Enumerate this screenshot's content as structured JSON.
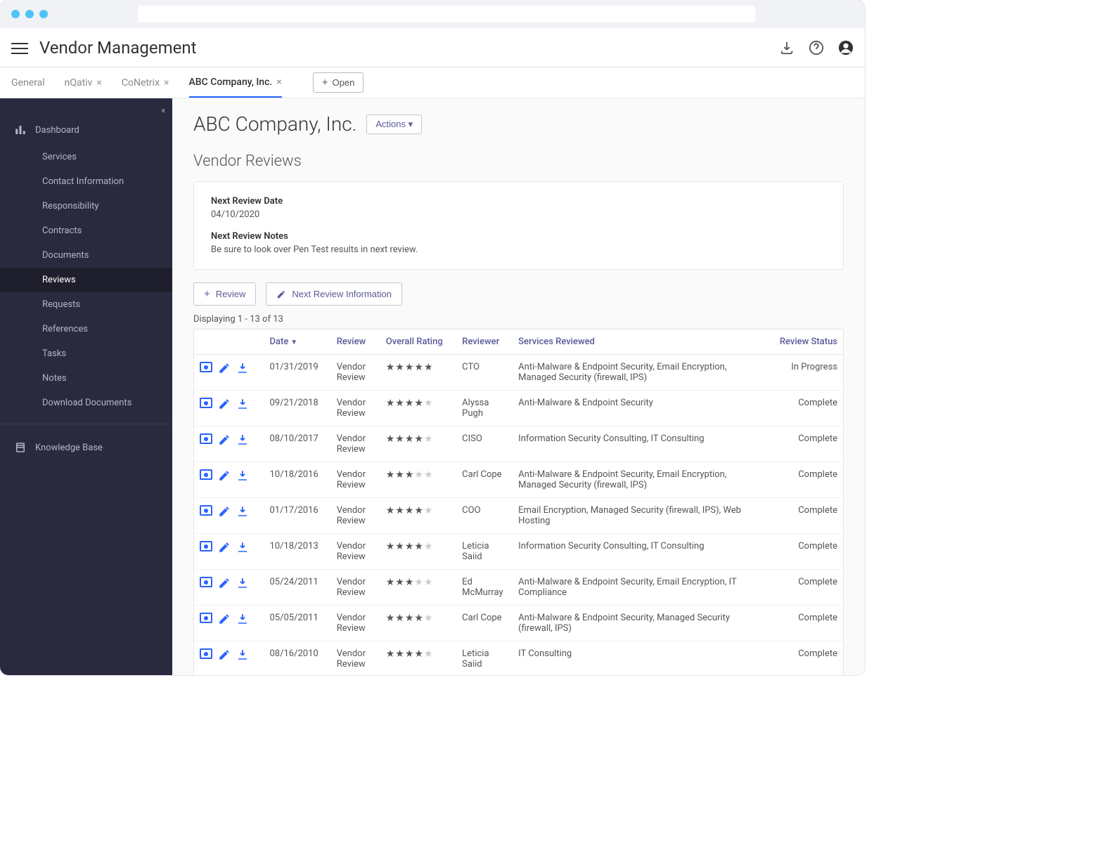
{
  "app_title": "Vendor Management",
  "tabs": [
    {
      "label": "General",
      "closable": false,
      "active": false
    },
    {
      "label": "nQativ",
      "closable": true,
      "active": false
    },
    {
      "label": "CoNetrix",
      "closable": true,
      "active": false
    },
    {
      "label": "ABC Company, Inc.",
      "closable": true,
      "active": true
    }
  ],
  "open_button": "Open",
  "sidebar": {
    "dashboard": "Dashboard",
    "items": [
      "Services",
      "Contact Information",
      "Responsibility",
      "Contracts",
      "Documents",
      "Reviews",
      "Requests",
      "References",
      "Tasks",
      "Notes",
      "Download Documents"
    ],
    "active_index": 5,
    "knowledge_base": "Knowledge Base"
  },
  "page": {
    "title": "ABC Company, Inc.",
    "actions_label": "Actions",
    "section": "Vendor Reviews",
    "next_review_date_label": "Next Review Date",
    "next_review_date": "04/10/2020",
    "next_review_notes_label": "Next Review Notes",
    "next_review_notes": "Be sure to look over Pen Test results in next review.",
    "review_button": "Review",
    "next_info_button": "Next Review Information",
    "pager": "Displaying 1 - 13 of 13",
    "columns": {
      "date": "Date",
      "review": "Review",
      "rating": "Overall Rating",
      "reviewer": "Reviewer",
      "services": "Services Reviewed",
      "status": "Review Status"
    }
  },
  "rows": [
    {
      "date": "01/31/2019",
      "review": "Vendor Review",
      "rating": 5,
      "reviewer": "CTO",
      "services": "Anti-Malware & Endpoint Security, Email Encryption, Managed Security (firewall, IPS)",
      "status": "In Progress"
    },
    {
      "date": "09/21/2018",
      "review": "Vendor Review",
      "rating": 4,
      "reviewer": "Alyssa Pugh",
      "services": "Anti-Malware & Endpoint Security",
      "status": "Complete"
    },
    {
      "date": "08/10/2017",
      "review": "Vendor Review",
      "rating": 4,
      "reviewer": "CISO",
      "services": "Information Security Consulting, IT Consulting",
      "status": "Complete"
    },
    {
      "date": "10/18/2016",
      "review": "Vendor Review",
      "rating": 3,
      "reviewer": "Carl Cope",
      "services": "Anti-Malware & Endpoint Security, Email Encryption, Managed Security (firewall, IPS)",
      "status": "Complete"
    },
    {
      "date": "01/17/2016",
      "review": "Vendor Review",
      "rating": 4,
      "reviewer": "COO",
      "services": "Email Encryption, Managed Security (firewall, IPS), Web Hosting",
      "status": "Complete"
    },
    {
      "date": "10/18/2013",
      "review": "Vendor Review",
      "rating": 4,
      "reviewer": "Leticia Saiid",
      "services": "Information Security Consulting, IT Consulting",
      "status": "Complete"
    },
    {
      "date": "05/24/2011",
      "review": "Vendor Review",
      "rating": 3,
      "reviewer": "Ed McMurray",
      "services": "Anti-Malware & Endpoint Security, Email Encryption, IT Compliance",
      "status": "Complete"
    },
    {
      "date": "05/05/2011",
      "review": "Vendor Review",
      "rating": 4,
      "reviewer": "Carl Cope",
      "services": "Anti-Malware & Endpoint Security, Managed Security (firewall, IPS)",
      "status": "Complete"
    },
    {
      "date": "08/16/2010",
      "review": "Vendor Review",
      "rating": 4,
      "reviewer": "Leticia Saiid",
      "services": "IT Consulting",
      "status": "Complete"
    }
  ]
}
